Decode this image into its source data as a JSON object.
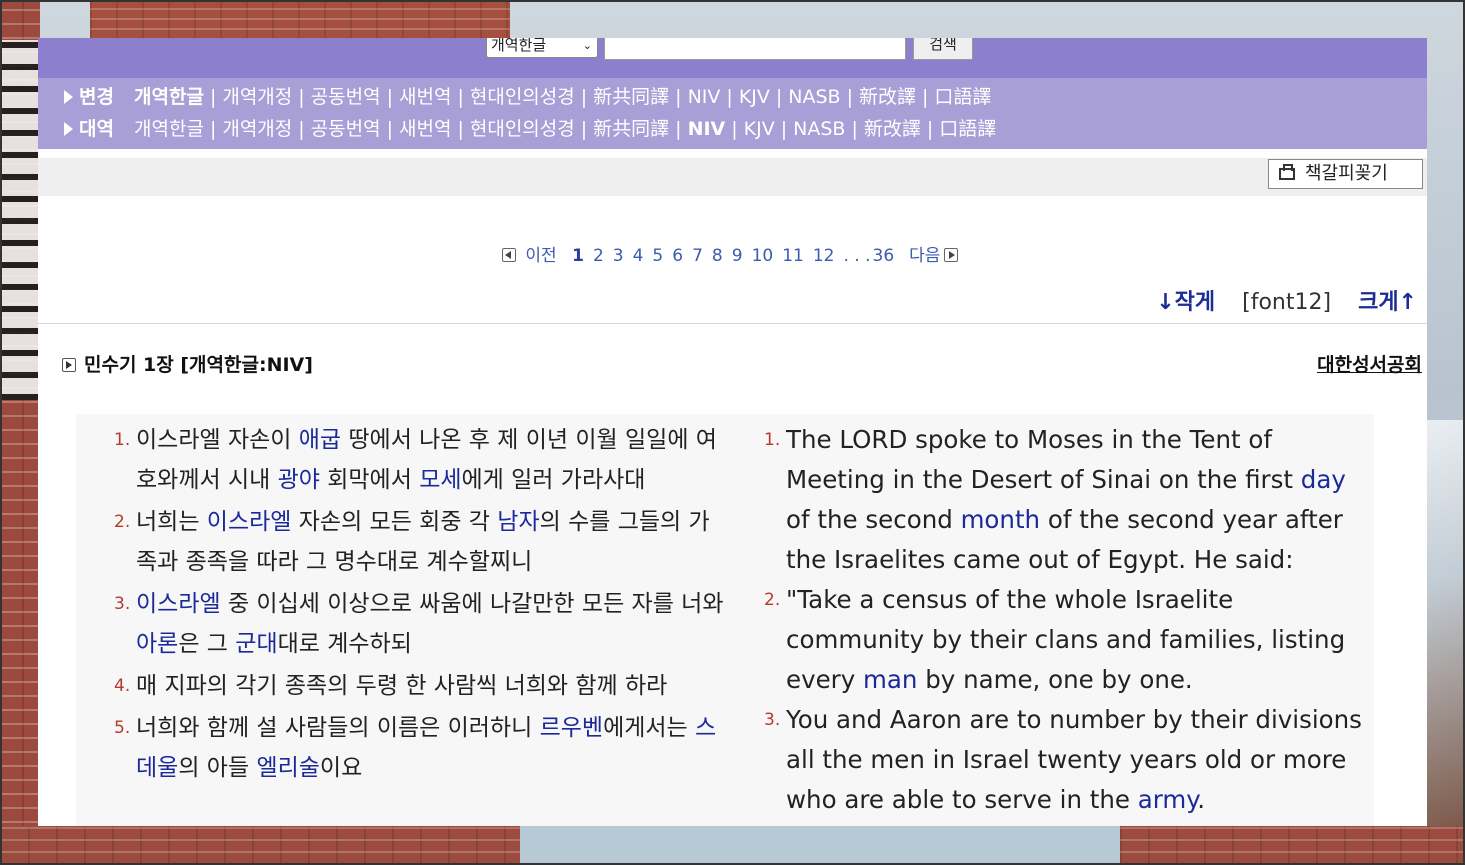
{
  "search": {
    "version_selected": "개역한글",
    "input_value": "",
    "button_label": "검색"
  },
  "versions": {
    "row1": {
      "head": "변경",
      "items": [
        "개역한글",
        "개역개정",
        "공동번역",
        "새번역",
        "현대인의성경",
        "新共同譯",
        "NIV",
        "KJV",
        "NASB",
        "新改譯",
        "口語譯"
      ],
      "active": "개역한글"
    },
    "row2": {
      "head": "대역",
      "items": [
        "개역한글",
        "개역개정",
        "공동번역",
        "새번역",
        "현대인의성경",
        "新共同譯",
        "NIV",
        "KJV",
        "NASB",
        "新改譯",
        "口語譯"
      ],
      "active": "NIV"
    }
  },
  "toolbar": {
    "bookmark_label": "책갈피꽂기"
  },
  "pagination": {
    "prev_label": "이전",
    "next_label": "다음",
    "pages": [
      "1",
      "2",
      "3",
      "4",
      "5",
      "6",
      "7",
      "8",
      "9",
      "10",
      "11",
      "12"
    ],
    "current": "1",
    "ellipsis": ". . .",
    "last": "36"
  },
  "font_size": {
    "smaller_label": "↓작게",
    "current_label": "[font12]",
    "larger_label": "크게↑"
  },
  "chapter": {
    "title": "민수기 1장 [개역한글:NIV]",
    "publisher": "대한성서공회"
  },
  "verses_korean": [
    {
      "num": "1.",
      "segments": [
        {
          "t": "이스라엘 자손이 "
        },
        {
          "t": "애굽",
          "k": true
        },
        {
          "t": " 땅에서 나온 후 제 이년 이월 일일에 여호와께서 시내 "
        },
        {
          "t": "광야",
          "k": true
        },
        {
          "t": " 회막에서 "
        },
        {
          "t": "모세",
          "k": true
        },
        {
          "t": "에게 일러 가라사대"
        }
      ]
    },
    {
      "num": "2.",
      "segments": [
        {
          "t": "너희는 "
        },
        {
          "t": "이스라엘",
          "k": true
        },
        {
          "t": " 자손의 모든 회중 각 "
        },
        {
          "t": "남자",
          "k": true
        },
        {
          "t": "의 수를 그들의 가족과 종족을 따라 그 명수대로 계수할찌니"
        }
      ]
    },
    {
      "num": "3.",
      "segments": [
        {
          "t": "이스라엘",
          "k": true
        },
        {
          "t": " 중 이십세 이상으로 싸움에 나갈만한 모든 자를 너와 "
        },
        {
          "t": "아론",
          "k": true
        },
        {
          "t": "은 그 "
        },
        {
          "t": "군대",
          "k": true
        },
        {
          "t": "대로 계수하되"
        }
      ]
    },
    {
      "num": "4.",
      "segments": [
        {
          "t": "매 지파의 각기 종족의 두령 한 사람씩 너희와 함께 하라"
        }
      ]
    },
    {
      "num": "5.",
      "segments": [
        {
          "t": "너희와 함께 설 사람들의 이름은 이러하니 "
        },
        {
          "t": "르우벤",
          "k": true
        },
        {
          "t": "에게서는 "
        },
        {
          "t": "스데울",
          "k": true
        },
        {
          "t": "의 아들 "
        },
        {
          "t": "엘리술",
          "k": true
        },
        {
          "t": "이요"
        }
      ]
    }
  ],
  "verses_english": [
    {
      "num": "1.",
      "segments": [
        {
          "t": "The LORD spoke to Moses in the Tent of Meeting in the Desert of Sinai on the first "
        },
        {
          "t": "day",
          "k": true
        },
        {
          "t": " of the second "
        },
        {
          "t": "month",
          "k": true
        },
        {
          "t": " of the second year after the Israelites came out of Egypt. He said:"
        }
      ]
    },
    {
      "num": "2.",
      "segments": [
        {
          "t": "\"Take a census of the whole Israelite community by their clans and families, listing every "
        },
        {
          "t": "man",
          "k": true
        },
        {
          "t": " by name, one by one."
        }
      ]
    },
    {
      "num": "3.",
      "segments": [
        {
          "t": "You and Aaron are to number by their divisions all the men in Israel twenty years old or more who are able to serve in the "
        },
        {
          "t": "army",
          "k": true
        },
        {
          "t": "."
        }
      ]
    }
  ],
  "colors": {
    "search_bar": "#8c7fcd",
    "version_bar": "#a79fd6",
    "keyword": "#1a2a9a",
    "verse_number": "#b6392b",
    "pagination_link": "#3c5bb0"
  }
}
